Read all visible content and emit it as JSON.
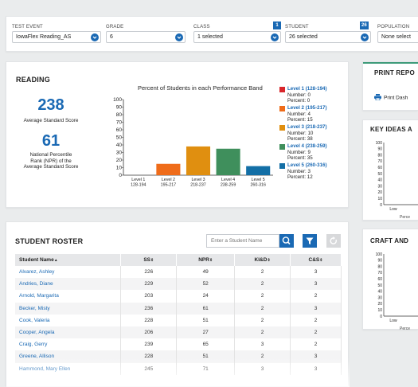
{
  "filters": [
    {
      "label": "TEST EVENT",
      "value": "IowaFlex Reading_AS",
      "count": ""
    },
    {
      "label": "GRADE",
      "value": "6",
      "count": ""
    },
    {
      "label": "CLASS",
      "value": "1 selected",
      "count": "1"
    },
    {
      "label": "STUDENT",
      "value": "26 selected",
      "count": "26"
    },
    {
      "label": "POPULATION",
      "value": "None select",
      "count": ""
    }
  ],
  "reading": {
    "title": "READING",
    "avg_ss": "238",
    "avg_ss_label": "Average Standard Score",
    "npr": "61",
    "npr_label": [
      "National Percentile",
      "Rank (NPR) of the",
      "Average Standard Score"
    ]
  },
  "chart_data": {
    "type": "bar",
    "title": "Percent of Students in each Performance Band",
    "categories": [
      "Level 1",
      "Level 2",
      "Level 3",
      "Level 4",
      "Level 5"
    ],
    "ranges": [
      "128-194",
      "195-217",
      "218-237",
      "238-259",
      "260-316"
    ],
    "values": [
      0,
      15,
      38,
      35,
      12
    ],
    "ylim": [
      0,
      100
    ],
    "yticks": [
      "100",
      "90",
      "80",
      "70",
      "60",
      "50",
      "40",
      "30",
      "20",
      "10",
      "0"
    ],
    "colors": [
      "#d9262b",
      "#ef6c1a",
      "#e08f10",
      "#3f8f5c",
      "#136fa6"
    ],
    "legend": [
      {
        "name": "Level 1 (128-194)",
        "number": "Number: 0",
        "percent": "Percent: 0"
      },
      {
        "name": "Level 2 (195-217)",
        "number": "Number: 4",
        "percent": "Percent: 15"
      },
      {
        "name": "Level 3 (218-237)",
        "number": "Number: 10",
        "percent": "Percent: 38"
      },
      {
        "name": "Level 4 (238-259)",
        "number": "Number: 9",
        "percent": "Percent: 35"
      },
      {
        "name": "Level 5 (260-316)",
        "number": "Number: 3",
        "percent": "Percent: 12"
      }
    ]
  },
  "print": {
    "title": "PRINT REPO",
    "link": "Print Dash"
  },
  "key_ideas": {
    "title": "KEY IDEAS A",
    "yticks": [
      "100",
      "90",
      "80",
      "70",
      "60",
      "50",
      "40",
      "30",
      "20",
      "10",
      "0"
    ],
    "xlabel": "Low",
    "ylabel_cut": "Perce"
  },
  "craft": {
    "title": "CRAFT AND",
    "yticks": [
      "100",
      "90",
      "80",
      "70",
      "60",
      "50",
      "40",
      "30",
      "20",
      "10",
      "0"
    ],
    "xlabel": "Low",
    "ylabel_cut": "Perce"
  },
  "roster": {
    "title": "STUDENT ROSTER",
    "search_placeholder": "Enter a Student Name",
    "columns": [
      "Student Name",
      "SS",
      "NPR",
      "KI&D",
      "C&S"
    ],
    "rows": [
      [
        "Alvarez, Ashley",
        "226",
        "49",
        "2",
        "3"
      ],
      [
        "Andries, Diane",
        "229",
        "52",
        "2",
        "3"
      ],
      [
        "Arnold, Margarita",
        "203",
        "24",
        "2",
        "2"
      ],
      [
        "Becker, Misty",
        "236",
        "61",
        "2",
        "3"
      ],
      [
        "Cook, Valeria",
        "228",
        "51",
        "2",
        "2"
      ],
      [
        "Cooper, Angela",
        "206",
        "27",
        "2",
        "2"
      ],
      [
        "Craig, Gerry",
        "239",
        "65",
        "3",
        "2"
      ],
      [
        "Greene, Allison",
        "228",
        "51",
        "2",
        "3"
      ],
      [
        "Hammond, Mary Ellen",
        "245",
        "71",
        "3",
        "3"
      ]
    ]
  }
}
